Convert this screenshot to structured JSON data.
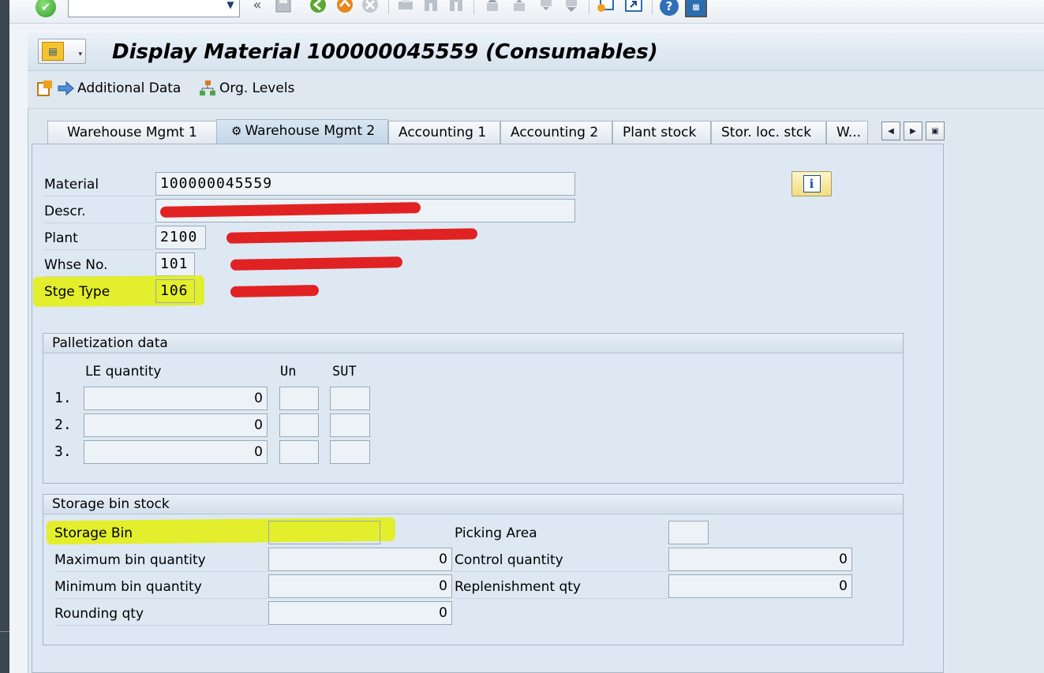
{
  "window": {
    "title": "Display Material 100000045559 (Consumables)"
  },
  "system_toolbar": {
    "command_field_value": "",
    "icons": [
      "enter-icon",
      "command-dropdown-icon",
      "collapse-icon",
      "save-icon",
      "back-icon",
      "exit-icon",
      "cancel-icon",
      "print-icon",
      "find-icon",
      "find-next-icon",
      "first-page-icon",
      "previous-page-icon",
      "next-page-icon",
      "last-page-icon",
      "new-session-icon",
      "shortcut-icon",
      "help-icon",
      "customize-layout-icon"
    ]
  },
  "app_toolbar": {
    "additional_data": "Additional Data",
    "org_levels": "Org. Levels"
  },
  "tabs": [
    {
      "label": "Warehouse Mgmt 1",
      "active": false
    },
    {
      "label": "Warehouse Mgmt 2",
      "active": true
    },
    {
      "label": "Accounting 1",
      "active": false
    },
    {
      "label": "Accounting 2",
      "active": false
    },
    {
      "label": "Plant stock",
      "active": false
    },
    {
      "label": "Stor. loc. stck",
      "active": false
    },
    {
      "label": "W...",
      "active": false
    }
  ],
  "header_fields": {
    "material_label": "Material",
    "material_value": "100000045559",
    "descr_label": "Descr.",
    "plant_label": "Plant",
    "plant_value": "2100",
    "whse_label": "Whse No.",
    "whse_value": "101",
    "stge_type_label": "Stge Type",
    "stge_type_value": "106"
  },
  "palletization": {
    "title": "Palletization data",
    "col_le_quantity": "LE quantity",
    "col_un": "Un",
    "col_sut": "SUT",
    "rows": [
      {
        "num": "1.",
        "qty": "0",
        "un": "",
        "sut": ""
      },
      {
        "num": "2.",
        "qty": "0",
        "un": "",
        "sut": ""
      },
      {
        "num": "3.",
        "qty": "0",
        "un": "",
        "sut": ""
      }
    ]
  },
  "storage_bin_stock": {
    "title": "Storage bin stock",
    "storage_bin_label": "Storage Bin",
    "storage_bin_value": "",
    "picking_area_label": "Picking Area",
    "picking_area_value": "",
    "max_bin_qty_label": "Maximum bin quantity",
    "max_bin_qty_value": "0",
    "control_qty_label": "Control quantity",
    "control_qty_value": "0",
    "min_bin_qty_label": "Minimum bin quantity",
    "min_bin_qty_value": "0",
    "replenishment_qty_label": "Replenishment qty",
    "replenishment_qty_value": "0",
    "rounding_qty_label": "Rounding qty",
    "rounding_qty_value": "0"
  },
  "colors": {
    "highlight": "#e3ee16",
    "redaction": "#e01010",
    "panel_bg": "#dde8f3"
  }
}
